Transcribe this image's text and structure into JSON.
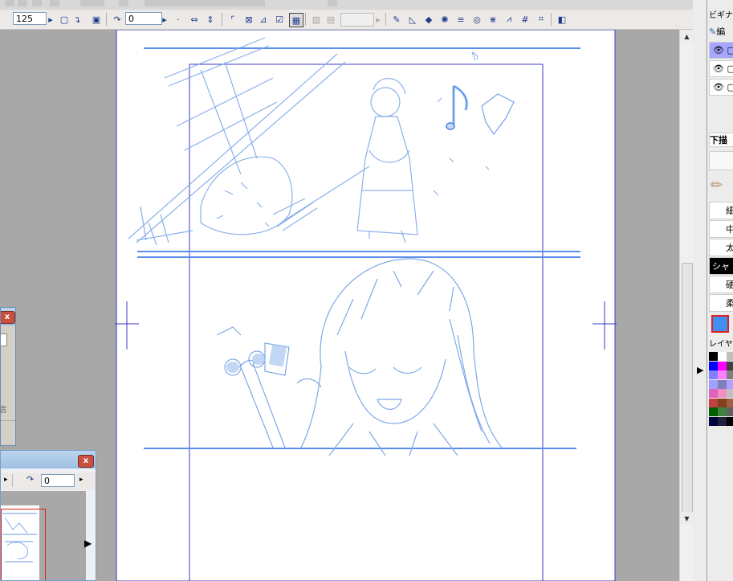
{
  "toolbar": {
    "zoom_value": "125",
    "rotation_value": "0"
  },
  "layers_panel": {
    "title": "ビギナ",
    "edit_label": "編",
    "layer_rows": [
      {
        "visible": true
      },
      {
        "visible": true
      },
      {
        "visible": true
      }
    ]
  },
  "subtool_panel": {
    "tab_label": "下描",
    "brushes": [
      {
        "label": "細"
      },
      {
        "label": "中"
      },
      {
        "label": "太"
      },
      {
        "label": "シャ",
        "selected": true
      },
      {
        "label": "硬"
      },
      {
        "label": "柔"
      }
    ],
    "current_color": "#3f90f0",
    "layer_color_label": "レイヤ",
    "palette": [
      [
        "#000000",
        "#ffffff",
        "#c0c0c0"
      ],
      [
        "#0000ff",
        "#ff00ff",
        "#404040"
      ],
      [
        "#8080ff",
        "#ff80ff",
        "#808080"
      ],
      [
        "#a0a0ff",
        "#8080c0",
        "#b0a0ff"
      ],
      [
        "#e060c0",
        "#f090c0",
        "#c0c0c0"
      ],
      [
        "#c04040",
        "#804020",
        "#a06040"
      ],
      [
        "#006000",
        "#408040",
        "#606060"
      ],
      [
        "#000040",
        "#202040",
        "#000000"
      ]
    ]
  },
  "navigator_window": {
    "close_label": "x",
    "rotation_value": "0"
  },
  "small_window": {
    "close_label": "x",
    "partial_text": "言"
  }
}
